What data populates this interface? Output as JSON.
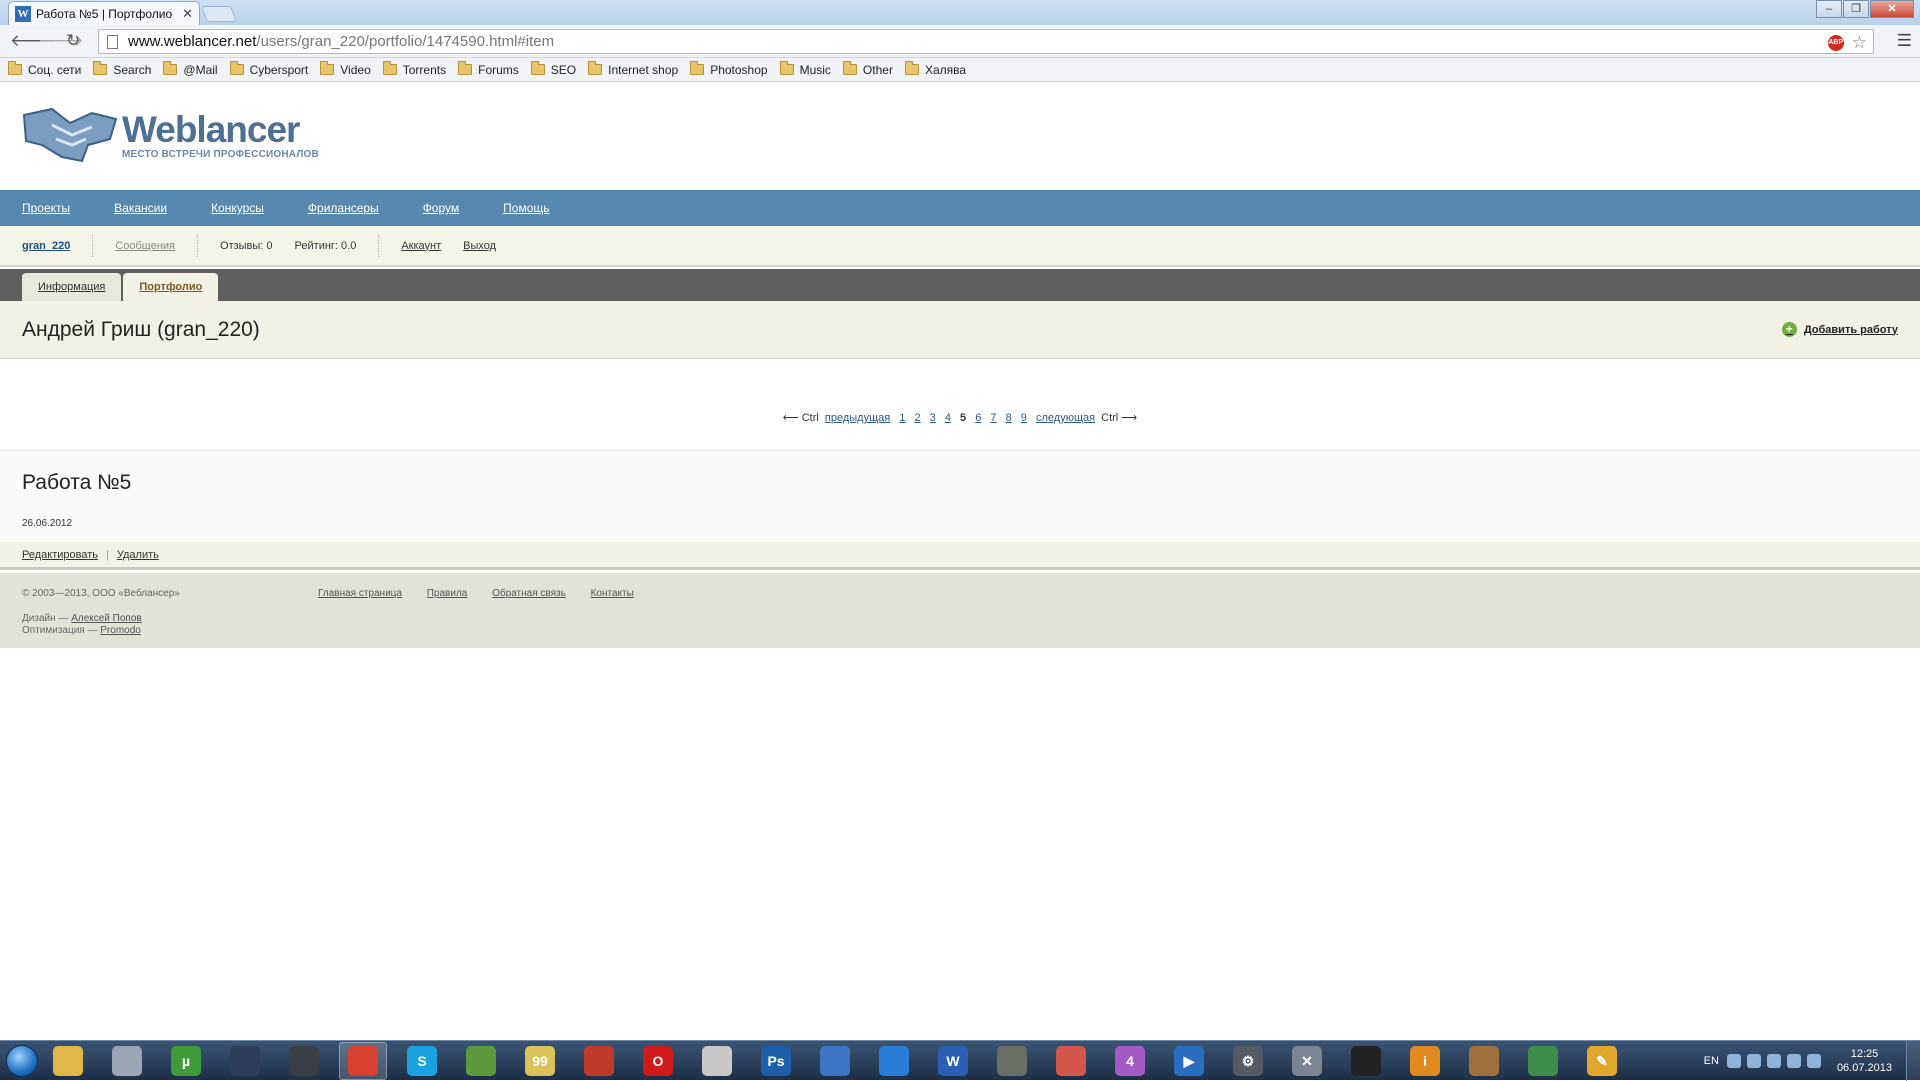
{
  "browser": {
    "tab_title": "Работа №5 | Портфолио",
    "tab_favicon": "W",
    "url_host": "www.weblancer.net",
    "url_path": "/users/gran_220/portfolio/1474590.html#item",
    "abp_label": "ABP",
    "bookmarks": [
      "Соц. сети",
      "Search",
      "@Mail",
      "Cybersport",
      "Video",
      "Torrents",
      "Forums",
      "SEO",
      "Internet shop",
      "Photoshop",
      "Music",
      "Other",
      "Халява"
    ]
  },
  "site": {
    "logo_name": "Weblancer",
    "logo_tagline": "МЕСТО ВСТРЕЧИ ПРОФЕССИОНАЛОВ",
    "nav": [
      "Проекты",
      "Вакансии",
      "Конкурсы",
      "Фрилансеры",
      "Форум",
      "Помощь"
    ],
    "user": {
      "username": "gran_220",
      "messages": "Сообщения",
      "reviews": "Отзывы: 0",
      "rating": "Рейтинг: 0.0",
      "account": "Аккаунт",
      "logout": "Выход"
    },
    "tabs": [
      "Информация",
      "Портфолио"
    ],
    "owner_title": "Андрей Гриш (gran_220)",
    "add_work": "Добавить работу",
    "pager": {
      "prev_hint": "⟵ Ctrl",
      "prev": "предыдущая",
      "pages": [
        "1",
        "2",
        "3",
        "4"
      ],
      "current": "5",
      "pages_after": [
        "6",
        "7",
        "8",
        "9"
      ],
      "next": "следующая",
      "next_hint": "Ctrl ⟶"
    },
    "work": {
      "title": "Работа №5",
      "date": "26.06.2012",
      "edit": "Редактировать",
      "delete": "Удалить"
    },
    "footer": {
      "copyright": "© 2003—2013, ООО «Веблансер»",
      "links": [
        "Главная страница",
        "Правила",
        "Обратная связь",
        "Контакты"
      ],
      "design_label": "Дизайн —",
      "design_author": "Алексей Попов",
      "opt_label": "Оптимизация —",
      "opt_author": "Promodo"
    }
  },
  "taskbar": {
    "apps": [
      {
        "name": "explorer-icon",
        "color": "#e2b74a",
        "glyph": ""
      },
      {
        "name": "media-icon",
        "color": "#9aa6b3",
        "glyph": ""
      },
      {
        "name": "utorrent-icon",
        "color": "#3f9b3a",
        "glyph": "µ"
      },
      {
        "name": "app-moon-icon",
        "color": "#2d3e58",
        "glyph": ""
      },
      {
        "name": "steam-icon",
        "color": "#3a3f46",
        "glyph": ""
      },
      {
        "name": "chrome-icon",
        "color": "#d8412f",
        "glyph": ""
      },
      {
        "name": "skype-icon",
        "color": "#1aa2e0",
        "glyph": "S"
      },
      {
        "name": "app-green-icon",
        "color": "#5c9a3d",
        "glyph": ""
      },
      {
        "name": "app-99-icon",
        "color": "#d9c25a",
        "glyph": "99"
      },
      {
        "name": "app-red-icon",
        "color": "#c03a2e",
        "glyph": ""
      },
      {
        "name": "opera-icon",
        "color": "#d21a1a",
        "glyph": "O"
      },
      {
        "name": "app-face-icon",
        "color": "#c8c8c8",
        "glyph": ""
      },
      {
        "name": "photoshop-icon",
        "color": "#1c5fa8",
        "glyph": "Ps"
      },
      {
        "name": "app-moon2-icon",
        "color": "#3d75c5",
        "glyph": ""
      },
      {
        "name": "app-bolt-icon",
        "color": "#2b7ed8",
        "glyph": ""
      },
      {
        "name": "word-icon",
        "color": "#2b5fb3",
        "glyph": "W"
      },
      {
        "name": "app-tank-icon",
        "color": "#6a6f66",
        "glyph": ""
      },
      {
        "name": "app-atom-icon",
        "color": "#d2564b",
        "glyph": ""
      },
      {
        "name": "app-purple-icon",
        "color": "#a35ac4",
        "glyph": "4"
      },
      {
        "name": "app-play-icon",
        "color": "#2a6fbf",
        "glyph": "▶"
      },
      {
        "name": "app-gear-icon",
        "color": "#555b63",
        "glyph": "⚙"
      },
      {
        "name": "app-tools-icon",
        "color": "#7b8490",
        "glyph": "✕"
      },
      {
        "name": "app-swirl-icon",
        "color": "#222",
        "glyph": ""
      },
      {
        "name": "app-info-icon",
        "color": "#e08a1f",
        "glyph": "i"
      },
      {
        "name": "app-bear-icon",
        "color": "#a0703c",
        "glyph": ""
      },
      {
        "name": "app-monitor-icon",
        "color": "#3e8d4a",
        "glyph": ""
      },
      {
        "name": "app-pen-icon",
        "color": "#e0a72c",
        "glyph": "✎"
      }
    ],
    "lang": "EN",
    "time": "12:25",
    "date": "06.07.2013"
  }
}
